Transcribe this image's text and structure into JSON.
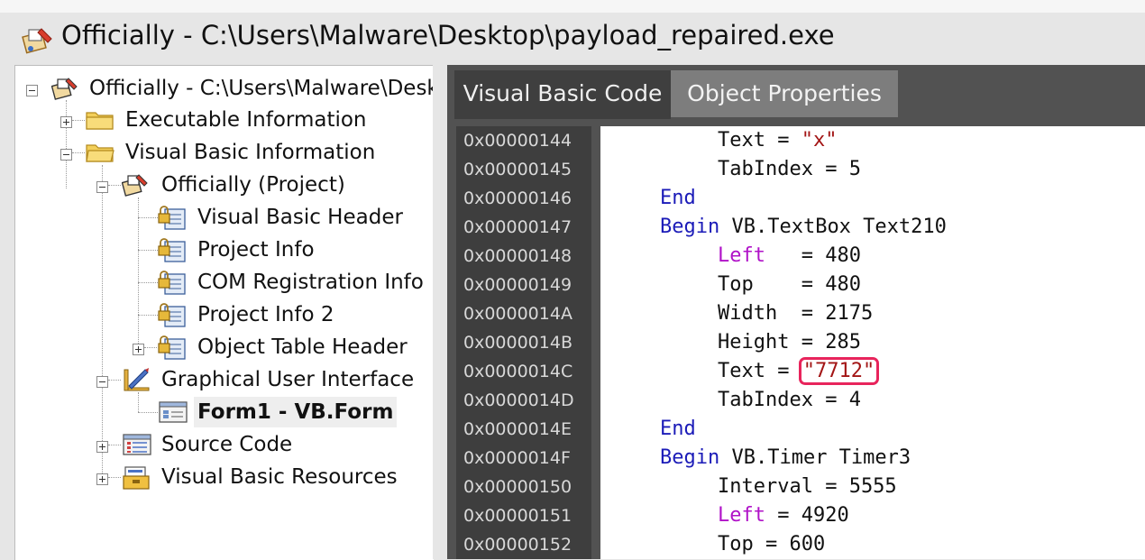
{
  "window": {
    "title": "Officially - C:\\Users\\Malware\\Desktop\\payload_repaired.exe",
    "icon": "vb-project-icon"
  },
  "tree": {
    "root": {
      "label": "Officially - C:\\Users\\Malware\\Desktop\\payload_repaired.exe",
      "icon": "vb-project-icon",
      "expanded": true
    },
    "items": [
      {
        "label": "Executable Information",
        "icon": "folder-icon",
        "expanded": false
      },
      {
        "label": "Visual Basic Information",
        "icon": "folder-icon",
        "expanded": true
      },
      {
        "label": "Officially (Project)",
        "icon": "vb-project-icon",
        "expanded": true
      },
      {
        "label": "Visual Basic Header",
        "icon": "locked-document-icon"
      },
      {
        "label": "Project Info",
        "icon": "locked-document-icon"
      },
      {
        "label": "COM Registration Info",
        "icon": "locked-document-icon"
      },
      {
        "label": "Project Info 2",
        "icon": "locked-document-icon"
      },
      {
        "label": "Object Table Header",
        "icon": "locked-document-icon",
        "expanded": false
      },
      {
        "label": "Graphical User Interface",
        "icon": "design-tools-icon",
        "expanded": true
      },
      {
        "label": "Form1 - VB.Form",
        "icon": "form-icon",
        "selected": true
      },
      {
        "label": "Source Code",
        "icon": "source-code-icon",
        "expanded": false
      },
      {
        "label": "Visual Basic Resources",
        "icon": "resources-icon",
        "expanded": false
      }
    ]
  },
  "tabs": [
    {
      "label": "Visual Basic Code",
      "active": true
    },
    {
      "label": "Object Properties",
      "active": false
    }
  ],
  "code": {
    "addresses": [
      "0x00000144",
      "0x00000145",
      "0x00000146",
      "0x00000147",
      "0x00000148",
      "0x00000149",
      "0x0000014A",
      "0x0000014B",
      "0x0000014C",
      "0x0000014D",
      "0x0000014E",
      "0x0000014F",
      "0x00000150",
      "0x00000151",
      "0x00000152"
    ],
    "lines": [
      {
        "indent": 2,
        "parts": [
          [
            "txt",
            "Text = "
          ],
          [
            "str",
            "\"x\""
          ]
        ]
      },
      {
        "indent": 2,
        "parts": [
          [
            "txt",
            "TabIndex = 5"
          ]
        ]
      },
      {
        "indent": 1,
        "parts": [
          [
            "kw",
            "End"
          ]
        ]
      },
      {
        "indent": 1,
        "parts": [
          [
            "kw",
            "Begin"
          ],
          [
            "txt",
            " VB.TextBox Text210"
          ]
        ]
      },
      {
        "indent": 2,
        "parts": [
          [
            "prop",
            "Left"
          ],
          [
            "txt",
            "   = 480"
          ]
        ]
      },
      {
        "indent": 2,
        "parts": [
          [
            "txt",
            "Top    = 480"
          ]
        ]
      },
      {
        "indent": 2,
        "parts": [
          [
            "txt",
            "Width  = 2175"
          ]
        ]
      },
      {
        "indent": 2,
        "parts": [
          [
            "txt",
            "Height = 285"
          ]
        ]
      },
      {
        "indent": 2,
        "parts": [
          [
            "txt",
            "Text = "
          ],
          [
            "strhl",
            "\"7712\""
          ]
        ]
      },
      {
        "indent": 2,
        "parts": [
          [
            "txt",
            "TabIndex = 4"
          ]
        ]
      },
      {
        "indent": 1,
        "parts": [
          [
            "kw",
            "End"
          ]
        ]
      },
      {
        "indent": 1,
        "parts": [
          [
            "kw",
            "Begin"
          ],
          [
            "txt",
            " VB.Timer Timer3"
          ]
        ]
      },
      {
        "indent": 2,
        "parts": [
          [
            "txt",
            "Interval = 5555"
          ]
        ]
      },
      {
        "indent": 2,
        "parts": [
          [
            "prop",
            "Left"
          ],
          [
            "txt",
            " = 4920"
          ]
        ]
      },
      {
        "indent": 2,
        "parts": [
          [
            "txt",
            "Top = 600"
          ]
        ]
      }
    ]
  },
  "colors": {
    "keyword": "#1b1bb8",
    "property": "#b012c8",
    "string": "#a31515",
    "highlight_border": "#e8245c"
  }
}
